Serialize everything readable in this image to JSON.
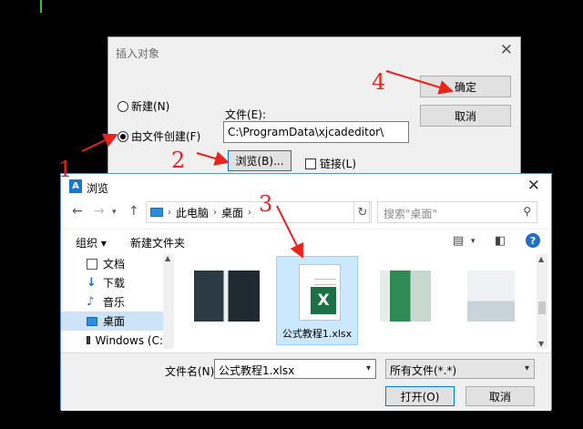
{
  "insert_dialog": {
    "title": "插入对象",
    "close": "✕",
    "radio_new": "新建(N)",
    "radio_from_file": "由文件创建(F)",
    "file_label": "文件(E):",
    "file_path": "C:\\ProgramData\\xjcadeditor\\",
    "browse_button": "浏览(B)...",
    "link_label": "链接(L)",
    "ok_button": "确定",
    "cancel_button": "取消"
  },
  "browse_dialog": {
    "title": "浏览",
    "close": "✕",
    "nav": {
      "back": "←",
      "forward": "→",
      "up": "↑",
      "refresh": "↻"
    },
    "breadcrumb": [
      "此电脑",
      "桌面"
    ],
    "search_placeholder": "搜索\"桌面\"",
    "toolbar": {
      "organize": "组织 ▾",
      "new_folder": "新建文件夹",
      "help": "?"
    },
    "sidebar": [
      "文档",
      "下载",
      "音乐",
      "桌面",
      "Windows (C:"
    ],
    "selected_sidebar": "桌面",
    "selected_file": "公式教程1.xlsx",
    "filename_label": "文件名(N):",
    "filename_value": "公式教程1.xlsx",
    "filetype_value": "所有文件(*.*)",
    "open_button": "打开(O)",
    "cancel_button": "取消"
  },
  "annotations": [
    "1",
    "2",
    "3",
    "4"
  ],
  "colors": {
    "annotation": "#e8251c",
    "excel": "#1d7044",
    "selection": "#cce8ff",
    "accent": "#0078d7"
  }
}
